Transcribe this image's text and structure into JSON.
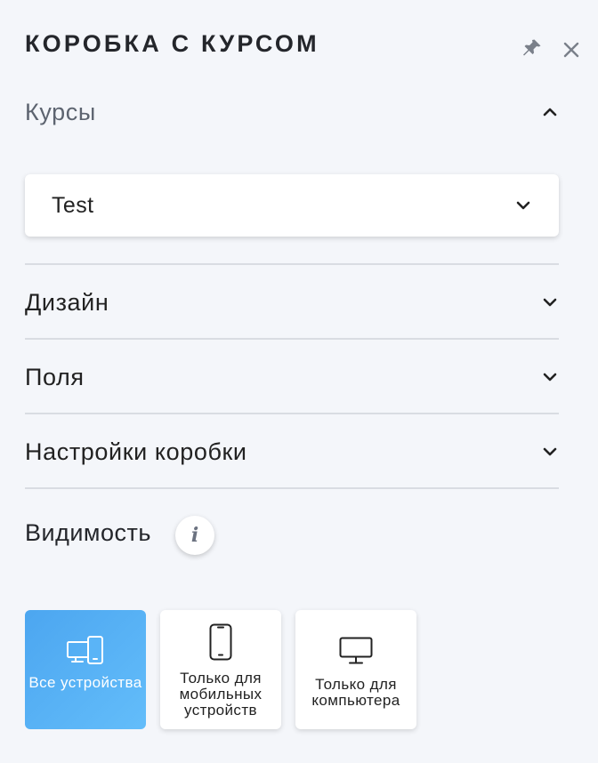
{
  "panel": {
    "title": "КОРОБКА С КУРСОМ",
    "pin_icon": "pin-icon",
    "close_icon": "close-icon"
  },
  "sections": {
    "courses": {
      "label": "Курсы",
      "expanded": true
    },
    "design": {
      "label": "Дизайн",
      "expanded": false
    },
    "fields": {
      "label": "Поля",
      "expanded": false
    },
    "box_settings": {
      "label": "Настройки коробки",
      "expanded": false
    }
  },
  "course_select": {
    "value": "Test"
  },
  "visibility": {
    "label": "Видимость",
    "info_icon": "info-icon",
    "options": [
      {
        "label": "Все устройства",
        "icon": "all-devices-icon",
        "selected": true
      },
      {
        "label": "Только для мобильных устройств",
        "icon": "mobile-icon",
        "selected": false
      },
      {
        "label": "Только для компьютера",
        "icon": "desktop-icon",
        "selected": false
      }
    ]
  },
  "colors": {
    "background": "#f4f6fa",
    "accent": "#4ca6f0",
    "text": "#24262b",
    "muted": "#5d6470"
  }
}
